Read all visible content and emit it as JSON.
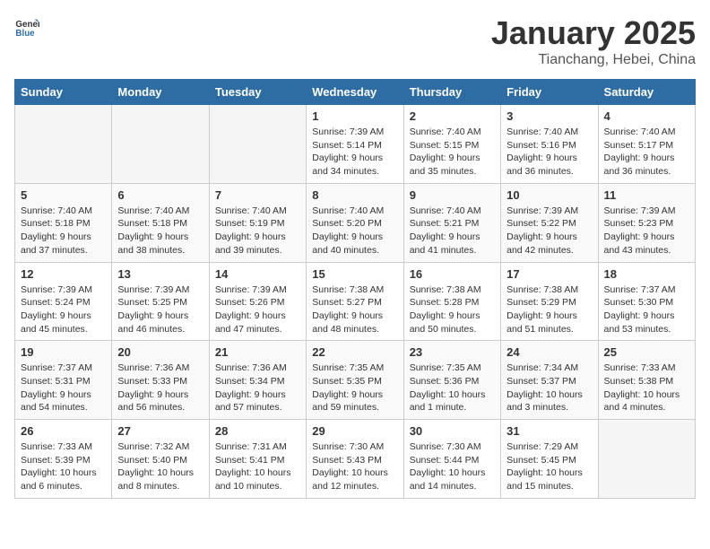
{
  "logo": {
    "text_general": "General",
    "text_blue": "Blue"
  },
  "calendar": {
    "title": "January 2025",
    "subtitle": "Tianchang, Hebei, China",
    "days_of_week": [
      "Sunday",
      "Monday",
      "Tuesday",
      "Wednesday",
      "Thursday",
      "Friday",
      "Saturday"
    ],
    "weeks": [
      [
        {
          "day": "",
          "info": ""
        },
        {
          "day": "",
          "info": ""
        },
        {
          "day": "",
          "info": ""
        },
        {
          "day": "1",
          "info": "Sunrise: 7:39 AM\nSunset: 5:14 PM\nDaylight: 9 hours\nand 34 minutes."
        },
        {
          "day": "2",
          "info": "Sunrise: 7:40 AM\nSunset: 5:15 PM\nDaylight: 9 hours\nand 35 minutes."
        },
        {
          "day": "3",
          "info": "Sunrise: 7:40 AM\nSunset: 5:16 PM\nDaylight: 9 hours\nand 36 minutes."
        },
        {
          "day": "4",
          "info": "Sunrise: 7:40 AM\nSunset: 5:17 PM\nDaylight: 9 hours\nand 36 minutes."
        }
      ],
      [
        {
          "day": "5",
          "info": "Sunrise: 7:40 AM\nSunset: 5:18 PM\nDaylight: 9 hours\nand 37 minutes."
        },
        {
          "day": "6",
          "info": "Sunrise: 7:40 AM\nSunset: 5:18 PM\nDaylight: 9 hours\nand 38 minutes."
        },
        {
          "day": "7",
          "info": "Sunrise: 7:40 AM\nSunset: 5:19 PM\nDaylight: 9 hours\nand 39 minutes."
        },
        {
          "day": "8",
          "info": "Sunrise: 7:40 AM\nSunset: 5:20 PM\nDaylight: 9 hours\nand 40 minutes."
        },
        {
          "day": "9",
          "info": "Sunrise: 7:40 AM\nSunset: 5:21 PM\nDaylight: 9 hours\nand 41 minutes."
        },
        {
          "day": "10",
          "info": "Sunrise: 7:39 AM\nSunset: 5:22 PM\nDaylight: 9 hours\nand 42 minutes."
        },
        {
          "day": "11",
          "info": "Sunrise: 7:39 AM\nSunset: 5:23 PM\nDaylight: 9 hours\nand 43 minutes."
        }
      ],
      [
        {
          "day": "12",
          "info": "Sunrise: 7:39 AM\nSunset: 5:24 PM\nDaylight: 9 hours\nand 45 minutes."
        },
        {
          "day": "13",
          "info": "Sunrise: 7:39 AM\nSunset: 5:25 PM\nDaylight: 9 hours\nand 46 minutes."
        },
        {
          "day": "14",
          "info": "Sunrise: 7:39 AM\nSunset: 5:26 PM\nDaylight: 9 hours\nand 47 minutes."
        },
        {
          "day": "15",
          "info": "Sunrise: 7:38 AM\nSunset: 5:27 PM\nDaylight: 9 hours\nand 48 minutes."
        },
        {
          "day": "16",
          "info": "Sunrise: 7:38 AM\nSunset: 5:28 PM\nDaylight: 9 hours\nand 50 minutes."
        },
        {
          "day": "17",
          "info": "Sunrise: 7:38 AM\nSunset: 5:29 PM\nDaylight: 9 hours\nand 51 minutes."
        },
        {
          "day": "18",
          "info": "Sunrise: 7:37 AM\nSunset: 5:30 PM\nDaylight: 9 hours\nand 53 minutes."
        }
      ],
      [
        {
          "day": "19",
          "info": "Sunrise: 7:37 AM\nSunset: 5:31 PM\nDaylight: 9 hours\nand 54 minutes."
        },
        {
          "day": "20",
          "info": "Sunrise: 7:36 AM\nSunset: 5:33 PM\nDaylight: 9 hours\nand 56 minutes."
        },
        {
          "day": "21",
          "info": "Sunrise: 7:36 AM\nSunset: 5:34 PM\nDaylight: 9 hours\nand 57 minutes."
        },
        {
          "day": "22",
          "info": "Sunrise: 7:35 AM\nSunset: 5:35 PM\nDaylight: 9 hours\nand 59 minutes."
        },
        {
          "day": "23",
          "info": "Sunrise: 7:35 AM\nSunset: 5:36 PM\nDaylight: 10 hours\nand 1 minute."
        },
        {
          "day": "24",
          "info": "Sunrise: 7:34 AM\nSunset: 5:37 PM\nDaylight: 10 hours\nand 3 minutes."
        },
        {
          "day": "25",
          "info": "Sunrise: 7:33 AM\nSunset: 5:38 PM\nDaylight: 10 hours\nand 4 minutes."
        }
      ],
      [
        {
          "day": "26",
          "info": "Sunrise: 7:33 AM\nSunset: 5:39 PM\nDaylight: 10 hours\nand 6 minutes."
        },
        {
          "day": "27",
          "info": "Sunrise: 7:32 AM\nSunset: 5:40 PM\nDaylight: 10 hours\nand 8 minutes."
        },
        {
          "day": "28",
          "info": "Sunrise: 7:31 AM\nSunset: 5:41 PM\nDaylight: 10 hours\nand 10 minutes."
        },
        {
          "day": "29",
          "info": "Sunrise: 7:30 AM\nSunset: 5:43 PM\nDaylight: 10 hours\nand 12 minutes."
        },
        {
          "day": "30",
          "info": "Sunrise: 7:30 AM\nSunset: 5:44 PM\nDaylight: 10 hours\nand 14 minutes."
        },
        {
          "day": "31",
          "info": "Sunrise: 7:29 AM\nSunset: 5:45 PM\nDaylight: 10 hours\nand 15 minutes."
        },
        {
          "day": "",
          "info": ""
        }
      ]
    ]
  }
}
